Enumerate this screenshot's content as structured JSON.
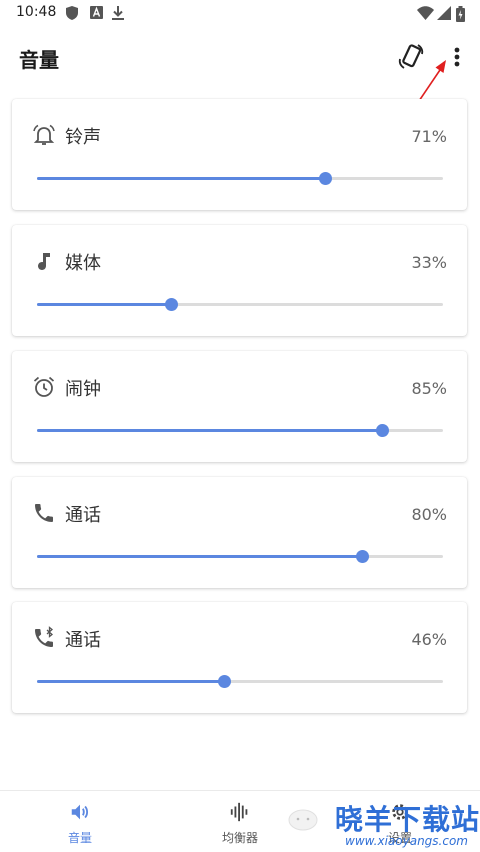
{
  "status_bar": {
    "time": "10:48",
    "icons": [
      "shield-icon",
      "a-badge-icon",
      "download-icon",
      "wifi-icon",
      "signal-icon",
      "battery-icon"
    ]
  },
  "app_bar": {
    "title": "音量",
    "actions": [
      "rotate-screen-icon",
      "more-vert-icon"
    ]
  },
  "annotation": {
    "color": "#e02020"
  },
  "volumes": [
    {
      "icon": "bell-icon",
      "label": "铃声",
      "percent_text": "71%",
      "level": 0.71
    },
    {
      "icon": "music-note-icon",
      "label": "媒体",
      "percent_text": "33%",
      "level": 0.33
    },
    {
      "icon": "alarm-clock-icon",
      "label": "闹钟",
      "percent_text": "85%",
      "level": 0.85
    },
    {
      "icon": "phone-icon",
      "label": "通话",
      "percent_text": "80%",
      "level": 0.8
    },
    {
      "icon": "bluetooth-phone-icon",
      "label": "通话",
      "percent_text": "46%",
      "level": 0.46
    }
  ],
  "bottom_nav": {
    "items": [
      {
        "icon": "volume-icon",
        "label": "音量",
        "active": true
      },
      {
        "icon": "equalizer-icon",
        "label": "均衡器",
        "active": false
      },
      {
        "icon": "settings-icon",
        "label": "设置",
        "active": false
      }
    ]
  },
  "watermark": {
    "text": "晓羊下载站",
    "url": "www.xiaoyangs.com"
  },
  "colors": {
    "accent": "#5b87e0",
    "track": "#dcdcdc",
    "watermark": "#2f6fd6"
  }
}
